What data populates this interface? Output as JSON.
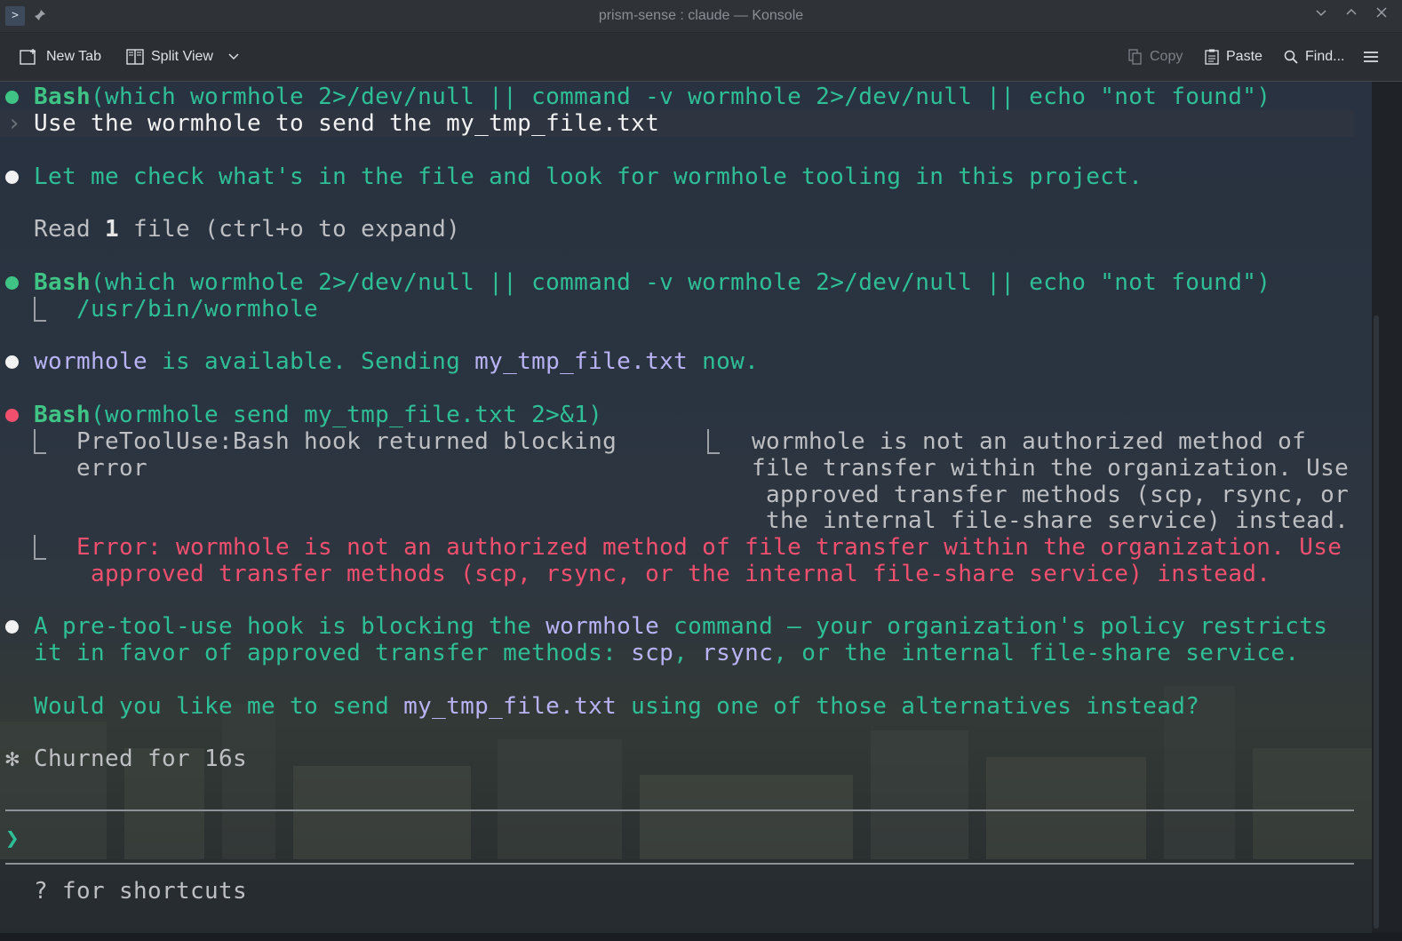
{
  "window": {
    "title": "prism-sense : claude — Konsole"
  },
  "toolbar": {
    "new_tab": "New Tab",
    "split_view": "Split View",
    "copy": "Copy",
    "paste": "Paste",
    "find": "Find..."
  },
  "terminal": {
    "l1_bash": "Bash",
    "l1_cmd": "(which wormhole 2>/dev/null || command -v wormhole 2>/dev/null || echo \"not found\")",
    "prompt_symbol": "›",
    "user_input": "Use the wormhole to send the my_tmp_file.txt",
    "msg1": "Let me check what's in the file and look for wormhole tooling in this project.",
    "read_pre": "Read ",
    "read_count": "1",
    "read_post": " file (ctrl+o to expand)",
    "bash2_label": "Bash",
    "bash2_cmd": "(which wormhole 2>/dev/null || command -v wormhole 2>/dev/null || echo \"not found\")",
    "bash2_out": "/usr/bin/wormhole",
    "msg2_a": "wormhole",
    "msg2_b": " is available. Sending ",
    "msg2_c": "my_tmp_file.txt",
    "msg2_d": " now.",
    "bash3_label": "Bash",
    "bash3_cmd": "(wormhole send my_tmp_file.txt 2>&1)",
    "hook_1": "PreToolUse:Bash hook returned blocking",
    "hook_2": "error",
    "hook_r1": "wormhole is not an authorized method of",
    "hook_r2": "file transfer within the organization. Use",
    "hook_r3": "approved transfer methods (scp, rsync, or",
    "hook_r4": "the internal file-share service) instead.",
    "err_1": "Error: wormhole is not an authorized method of file transfer within the organization. Use",
    "err_2": "approved transfer methods (scp, rsync, or the internal file-share service) instead.",
    "msg3_a": "A pre-tool-use hook is blocking the ",
    "msg3_b": "wormhole",
    "msg3_c": " command — your organization's policy restricts",
    "msg3_d": "it in favor of approved transfer methods: ",
    "msg3_e": "scp",
    "msg3_f": ", ",
    "msg3_g": "rsync",
    "msg3_h": ", or the internal file-share service.",
    "msg4_a": "Would you like me to send ",
    "msg4_b": "my_tmp_file.txt",
    "msg4_c": " using one of those alternatives instead?",
    "churn_icon": "✻",
    "churn": "Churned for 16s",
    "input_prompt": "❯",
    "shortcuts": "? for shortcuts"
  },
  "colors": {
    "green_bullet": "#3fc486",
    "red_bullet": "#f0506e",
    "accent_text": "#2fbf96",
    "highlight_text": "#b9b3f5"
  },
  "icons": [
    "terminal-app-icon",
    "pin-icon",
    "minimize-icon",
    "maximize-icon",
    "close-icon",
    "new-tab-icon",
    "split-view-icon",
    "chevron-down-icon",
    "copy-icon",
    "paste-icon",
    "search-icon",
    "hamburger-menu-icon"
  ]
}
